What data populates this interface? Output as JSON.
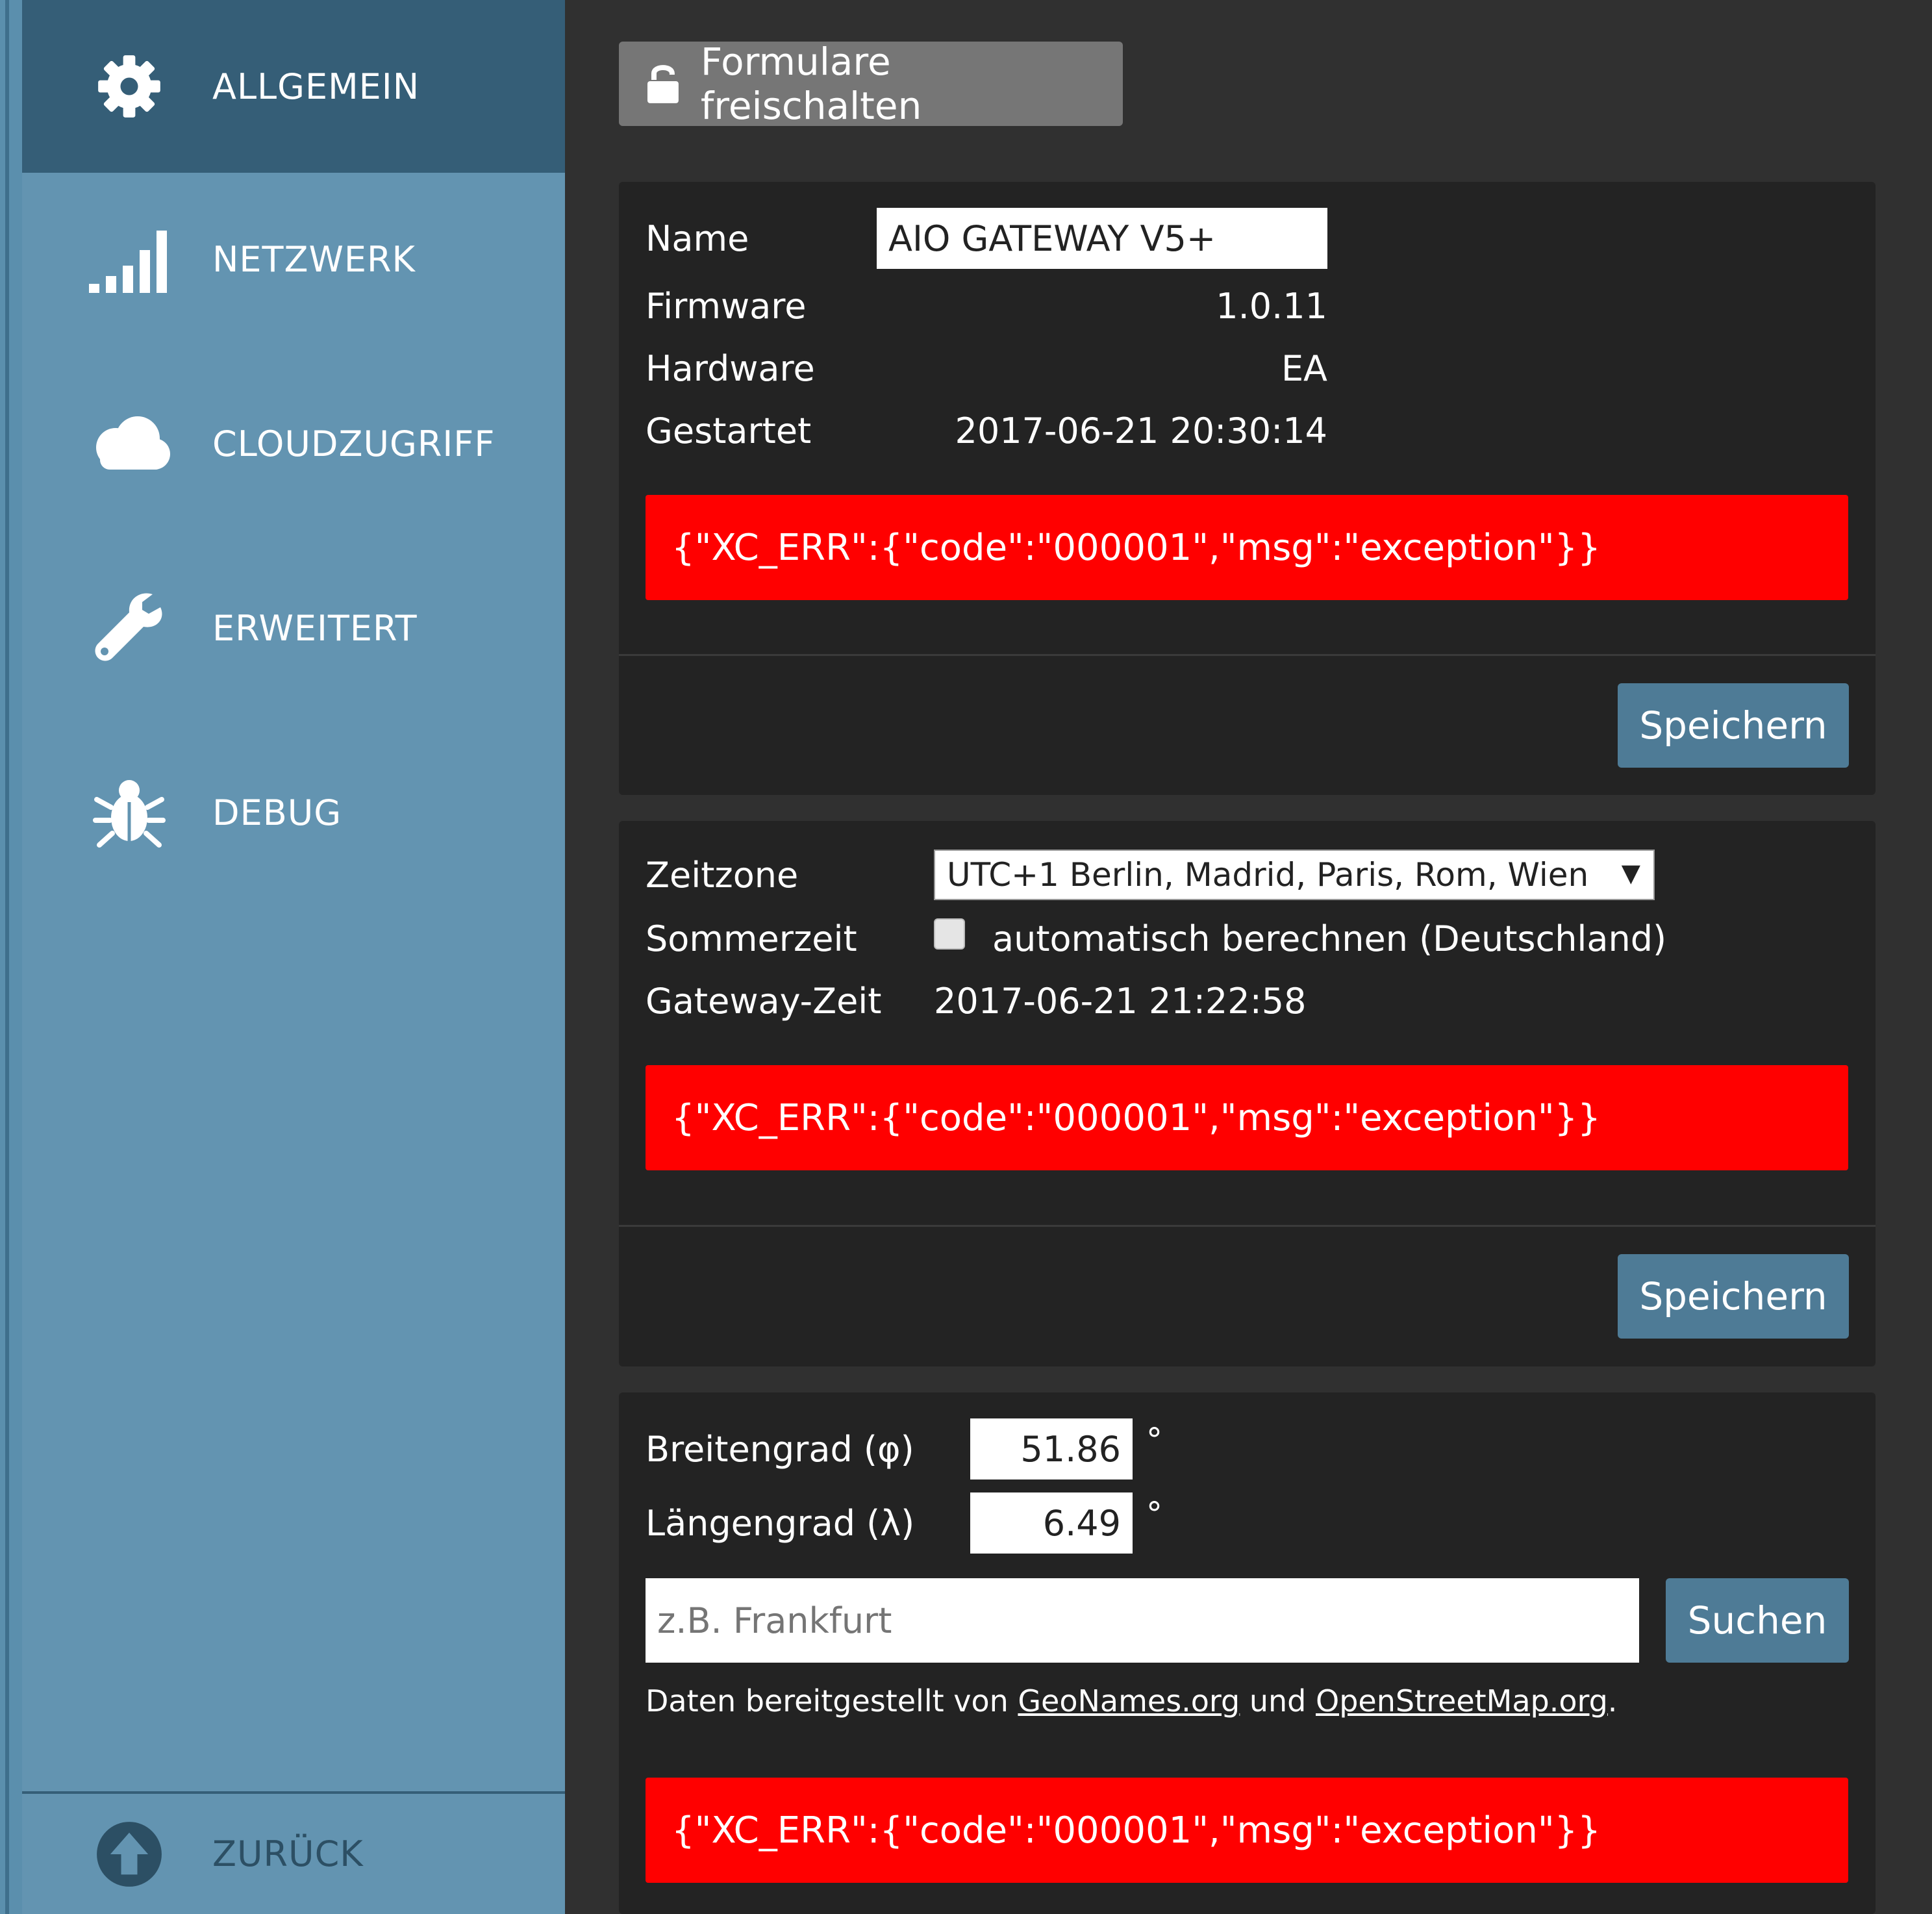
{
  "sidebar": {
    "items": [
      {
        "label": "ALLGEMEIN",
        "icon": "gear-icon",
        "active": true
      },
      {
        "label": "NETZWERK",
        "icon": "signal-bars-icon",
        "active": false
      },
      {
        "label": "CLOUDZUGRIFF",
        "icon": "cloud-icon",
        "active": false
      },
      {
        "label": "ERWEITERT",
        "icon": "wrench-icon",
        "active": false
      },
      {
        "label": "DEBUG",
        "icon": "bug-icon",
        "active": false
      }
    ],
    "back": {
      "label": "ZURÜCK",
      "icon": "arrow-up-circle-icon"
    }
  },
  "toolbar": {
    "unlock_label": "Formulare freischalten",
    "unlock_icon": "unlock-icon"
  },
  "device": {
    "name_label": "Name",
    "name_value": "AIO GATEWAY V5+",
    "firmware_label": "Firmware",
    "firmware_value": "1.0.11",
    "hardware_label": "Hardware",
    "hardware_value": "EA",
    "started_label": "Gestartet",
    "started_value": "2017-06-21 20:30:14",
    "error": "{\"XC_ERR\":{\"code\":\"000001\",\"msg\":\"exception\"}}",
    "save_label": "Speichern"
  },
  "time": {
    "timezone_label": "Zeitzone",
    "timezone_value": "UTC+1  Berlin, Madrid, Paris, Rom, Wien",
    "dst_label": "Sommerzeit",
    "dst_checkbox_label": "automatisch berechnen (Deutschland)",
    "dst_checked": false,
    "gateway_time_label": "Gateway-Zeit",
    "gateway_time_value": "2017-06-21 21:22:58",
    "error": "{\"XC_ERR\":{\"code\":\"000001\",\"msg\":\"exception\"}}",
    "save_label": "Speichern"
  },
  "location": {
    "latitude_label": "Breitengrad (φ)",
    "latitude_value": "51.86",
    "longitude_label": "Längengrad (λ)",
    "longitude_value": "6.49",
    "degree_symbol": "°",
    "search_placeholder": "z.B. Frankfurt",
    "search_label": "Suchen",
    "credit_prefix": "Daten bereitgestellt von ",
    "credit_link1": "GeoNames.org",
    "credit_mid": " und ",
    "credit_link2": "OpenStreetMap.org",
    "credit_suffix": ".",
    "error": "{\"XC_ERR\":{\"code\":\"000001\",\"msg\":\"exception\"}}"
  },
  "colors": {
    "sidebar_bg": "#6394b1",
    "sidebar_active": "#355e77",
    "main_bg": "#303030",
    "panel_bg": "#232323",
    "error_bg": "#ff0000",
    "button_blue": "#4e7b96",
    "button_gray": "#767676"
  }
}
